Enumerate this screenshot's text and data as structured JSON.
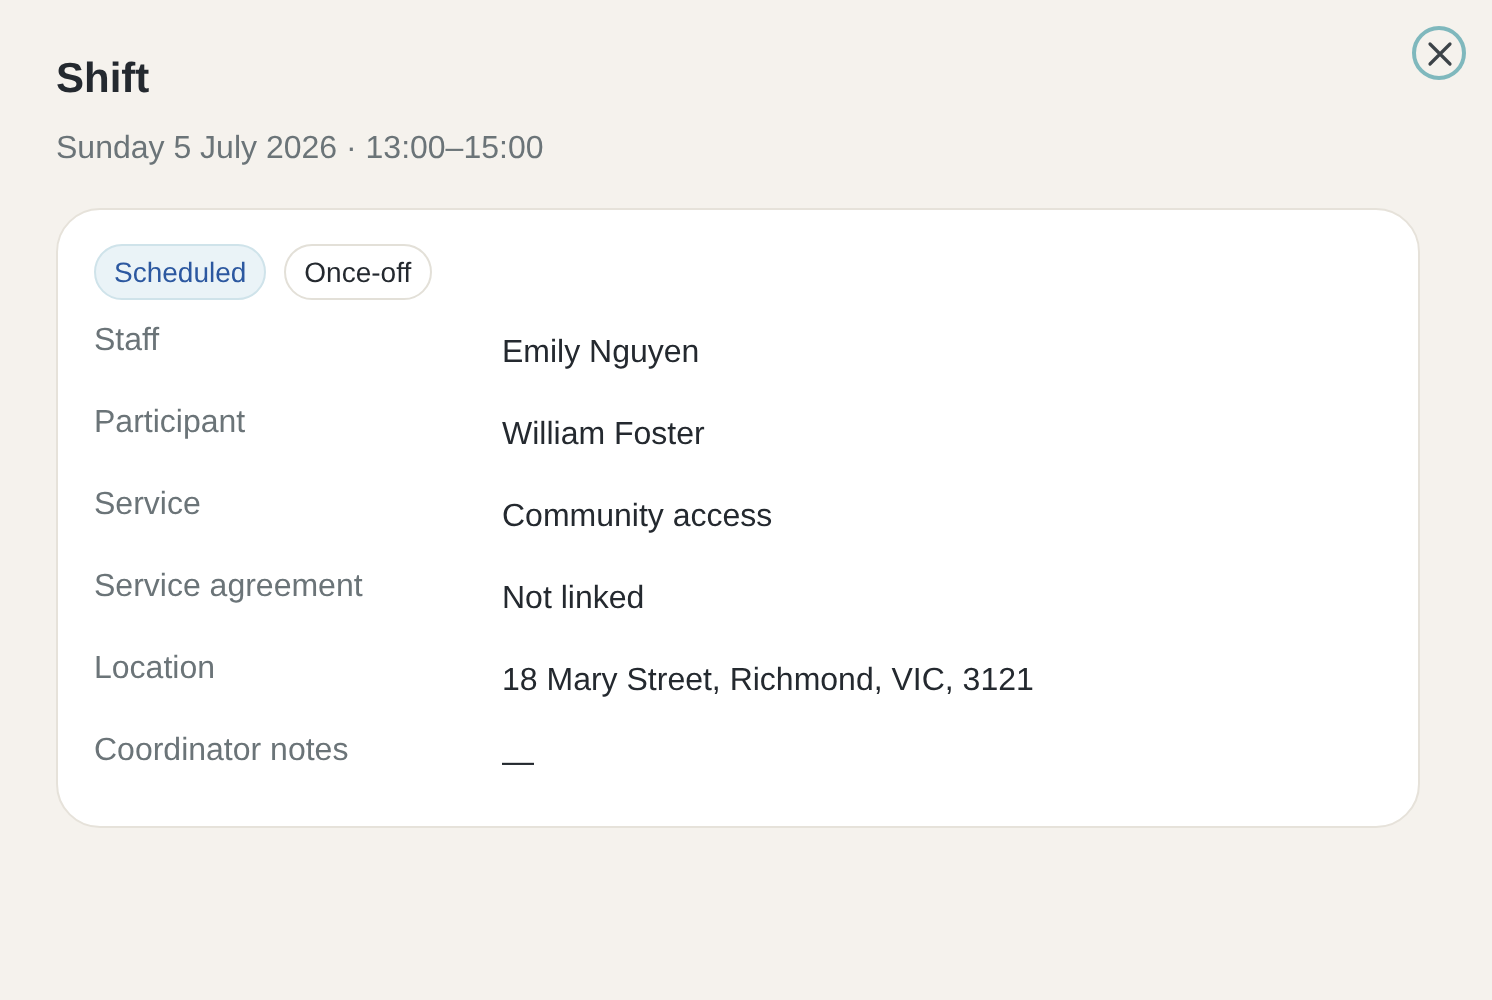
{
  "dialog": {
    "title": "Shift",
    "subtitle": "Sunday 5 July 2026 · 13:00–15:00"
  },
  "badges": [
    {
      "label": "Scheduled",
      "kind": "status"
    },
    {
      "label": "Once-off",
      "kind": "plain"
    }
  ],
  "details": [
    {
      "label": "Staff",
      "value": "Emily Nguyen"
    },
    {
      "label": "Participant",
      "value": "William Foster"
    },
    {
      "label": "Service",
      "value": "Community access"
    },
    {
      "label": "Service agreement",
      "value": "Not linked"
    },
    {
      "label": "Location",
      "value": "18 Mary Street, Richmond, VIC, 3121"
    },
    {
      "label": "Coordinator notes",
      "value": "—"
    }
  ]
}
